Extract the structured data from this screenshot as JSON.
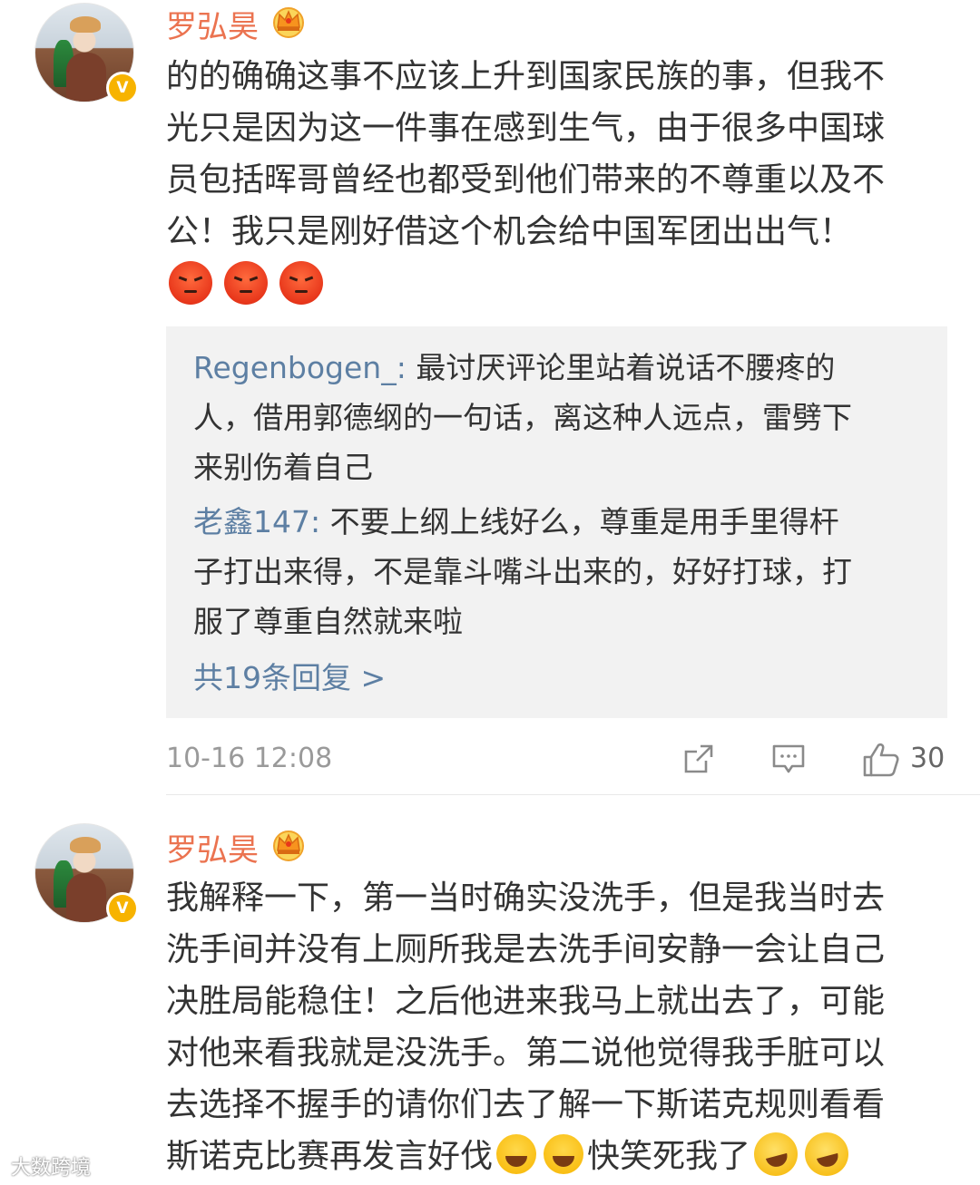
{
  "comments": [
    {
      "username": "罗弘昊",
      "badge": "V",
      "lines": [
        "的的确确这事不应该上升到国家民族的事，但我不",
        "光只是因为这一件事在感到生气，由于很多中国球",
        "员包括晖哥曾经也都受到他们带来的不尊重以及不",
        "公！我只是刚好借这个机会给中国军团出出气！"
      ],
      "emojis": [
        "angry-emoji",
        "angry-emoji",
        "angry-emoji"
      ],
      "replies": [
        {
          "name": "Regenbogen_",
          "separator": ": ",
          "lines": [
            "最讨厌评论里站着说话不腰疼的",
            "人，借用郭德纲的一句话，离这种人远点，雷劈下",
            "来别伤着自己"
          ]
        },
        {
          "name": "老鑫147",
          "separator": ": ",
          "lines": [
            "不要上纲上线好么，尊重是用手里得杆",
            "子打出来得，不是靠斗嘴斗出来的，好好打球，打",
            "服了尊重自然就来啦"
          ]
        }
      ],
      "more_replies": "共19条回复 >",
      "timestamp": "10-16 12:08",
      "like_count": "30"
    },
    {
      "username": "罗弘昊",
      "badge": "V",
      "lines": [
        "我解释一下，第一当时确实没洗手，但是我当时去",
        "洗手间并没有上厕所我是去洗手间安静一会让自己",
        "决胜局能稳住！之后他进来我马上就出去了，可能",
        "对他来看我就是没洗手。第二说他觉得我手脏可以",
        "去选择不握手的请你们去了解一下斯诺克规则看看"
      ],
      "last_line_a": "斯诺克比赛再发言好伐",
      "last_line_b": "快笑死我了"
    }
  ],
  "watermark": "大数跨境",
  "colors": {
    "username": "#eb7350",
    "reply_name": "#5d7fa3",
    "reply_bg": "#f2f2f2",
    "verified": "#f7b300"
  }
}
